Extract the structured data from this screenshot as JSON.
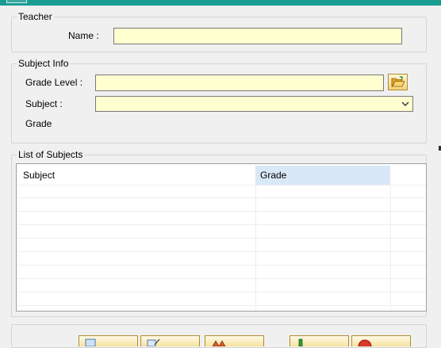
{
  "teacher_group": {
    "legend": "Teacher",
    "name_label": "Name :",
    "name_value": ""
  },
  "subject_group": {
    "legend": "Subject Info",
    "grade_level_label": "Grade Level :",
    "grade_level_value": "",
    "subject_label": "Subject :",
    "subject_value": "",
    "grade_label": "Grade"
  },
  "subjects_group": {
    "legend": "List of Subjects",
    "columns": [
      "Subject",
      "Grade"
    ],
    "rows": []
  },
  "colors": {
    "title_bar": "#1a9c93",
    "input_bg": "#ffffd0",
    "selected_header": "#d9e8f7"
  },
  "icons": {
    "browse": "folder-open-icon",
    "dropdown": "chevron-down-icon",
    "toolbar": [
      "new-icon",
      "edit-icon",
      "delete-icon",
      "save-icon",
      "close-icon"
    ]
  }
}
